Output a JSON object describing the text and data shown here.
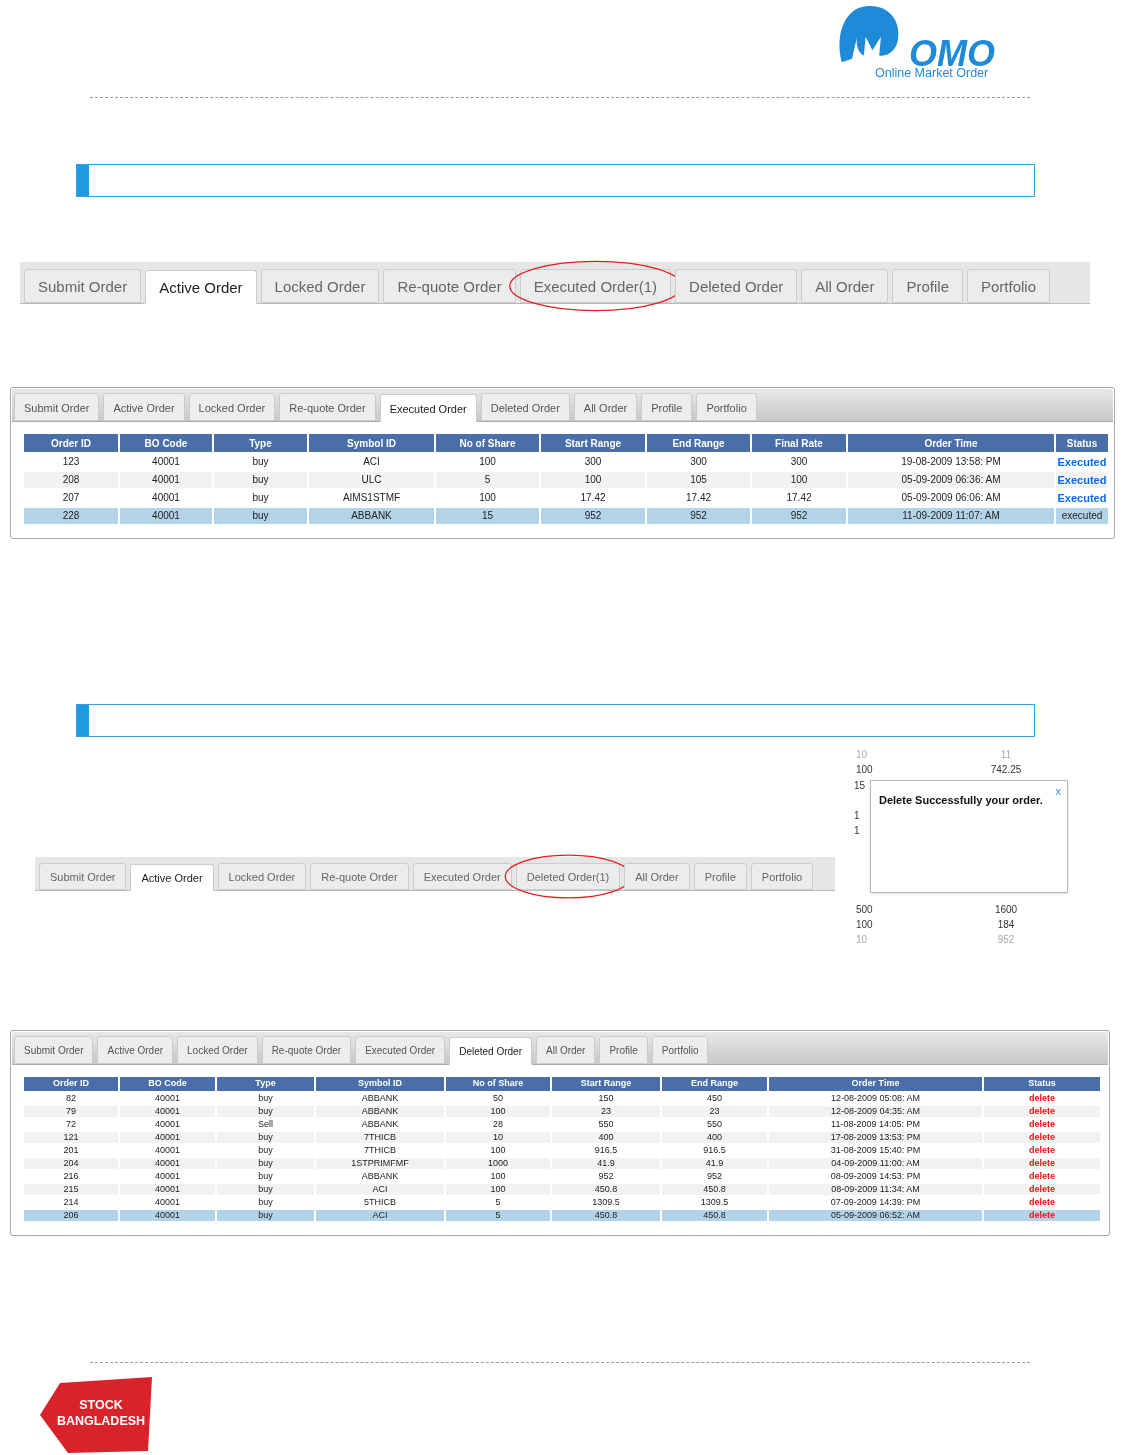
{
  "header_logo": {
    "wordmark": "OMO",
    "tagline": "Online Market Order"
  },
  "section_bars": [
    {
      "kind": "bar"
    },
    {
      "kind": "bar"
    }
  ],
  "main_tabs_1": [
    {
      "label": "Submit Order",
      "selected": false,
      "circled": false
    },
    {
      "label": "Active Order",
      "selected": true,
      "circled": false
    },
    {
      "label": "Locked Order",
      "selected": false,
      "circled": false
    },
    {
      "label": "Re-quote Order",
      "selected": false,
      "circled": false
    },
    {
      "label": "Executed Order(1)",
      "selected": false,
      "circled": true
    },
    {
      "label": "Deleted Order",
      "selected": false,
      "circled": false
    },
    {
      "label": "All Order",
      "selected": false,
      "circled": false
    },
    {
      "label": "Profile",
      "selected": false,
      "circled": false
    },
    {
      "label": "Portfolio",
      "selected": false,
      "circled": false
    }
  ],
  "executed_panel": {
    "kind": "executed",
    "tabs": [
      {
        "label": "Submit Order",
        "selected": false
      },
      {
        "label": "Active Order",
        "selected": false
      },
      {
        "label": "Locked Order",
        "selected": false
      },
      {
        "label": "Re-quote Order",
        "selected": false
      },
      {
        "label": "Executed Order",
        "selected": true
      },
      {
        "label": "Deleted Order",
        "selected": false
      },
      {
        "label": "All Order",
        "selected": false
      },
      {
        "label": "Profile",
        "selected": false
      },
      {
        "label": "Portfolio",
        "selected": false
      }
    ],
    "columns": [
      "Order ID",
      "BO Code",
      "Type",
      "Symbol ID",
      "No of Share",
      "Start Range",
      "End Range",
      "Final Rate",
      "Order Time",
      "Status"
    ],
    "rows": [
      {
        "cells": [
          "123",
          "40001",
          "buy",
          "ACI",
          "100",
          "300",
          "300",
          "300",
          "19-08-2009 13:58: PM",
          "Executed"
        ],
        "selected": false
      },
      {
        "cells": [
          "208",
          "40001",
          "buy",
          "ULC",
          "5",
          "100",
          "105",
          "100",
          "05-09-2009 06:36: AM",
          "Executed"
        ],
        "selected": false
      },
      {
        "cells": [
          "207",
          "40001",
          "buy",
          "AIMS1STMF",
          "100",
          "17.42",
          "17.42",
          "17.42",
          "05-09-2009 06:06: AM",
          "Executed"
        ],
        "selected": false
      },
      {
        "cells": [
          "228",
          "40001",
          "buy",
          "ABBANK",
          "15",
          "952",
          "952",
          "952",
          "11-09-2009 11:07: AM",
          "executed"
        ],
        "selected": true
      }
    ]
  },
  "main_tabs_2": [
    {
      "label": "Submit Order",
      "selected": false,
      "circled": false
    },
    {
      "label": "Active Order",
      "selected": true,
      "circled": false
    },
    {
      "label": "Locked Order",
      "selected": false,
      "circled": false
    },
    {
      "label": "Re-quote Order",
      "selected": false,
      "circled": false
    },
    {
      "label": "Executed Order",
      "selected": false,
      "circled": false
    },
    {
      "label": "Deleted Order(1)",
      "selected": false,
      "circled": true
    },
    {
      "label": "All Order",
      "selected": false,
      "circled": false
    },
    {
      "label": "Profile",
      "selected": false,
      "circled": false
    },
    {
      "label": "Portfolio",
      "selected": false,
      "circled": false
    }
  ],
  "popup_fragment": {
    "rows_above": [
      [
        "10",
        "11"
      ],
      [
        "100",
        "742.25"
      ]
    ],
    "peeks": [
      "15",
      "1",
      "1"
    ],
    "rows_below": [
      [
        "500",
        "1600"
      ],
      [
        "100",
        "184"
      ],
      [
        "10",
        "952"
      ]
    ],
    "message": "Delete Successfully your order.",
    "close": "x"
  },
  "deleted_panel": {
    "kind": "deleted",
    "tabs": [
      {
        "label": "Submit Order",
        "selected": false
      },
      {
        "label": "Active Order",
        "selected": false
      },
      {
        "label": "Locked Order",
        "selected": false
      },
      {
        "label": "Re-quote Order",
        "selected": false
      },
      {
        "label": "Executed Order",
        "selected": false
      },
      {
        "label": "Deleted Order",
        "selected": true
      },
      {
        "label": "All Order",
        "selected": false
      },
      {
        "label": "Profile",
        "selected": false
      },
      {
        "label": "Portfolio",
        "selected": false
      }
    ],
    "columns": [
      "Order ID",
      "BO Code",
      "Type",
      "Symbol ID",
      "No of Share",
      "Start Range",
      "End Range",
      "Order Time",
      "Status"
    ],
    "rows": [
      {
        "cells": [
          "82",
          "40001",
          "buy",
          "ABBANK",
          "50",
          "150",
          "450",
          "12-08-2009 05:08: AM",
          "delete"
        ],
        "selected": false
      },
      {
        "cells": [
          "79",
          "40001",
          "buy",
          "ABBANK",
          "100",
          "23",
          "23",
          "12-08-2009 04:35: AM",
          "delete"
        ],
        "selected": false
      },
      {
        "cells": [
          "72",
          "40001",
          "Sell",
          "ABBANK",
          "28",
          "550",
          "550",
          "11-08-2009 14:05: PM",
          "delete"
        ],
        "selected": false
      },
      {
        "cells": [
          "121",
          "40001",
          "buy",
          "7THICB",
          "10",
          "400",
          "400",
          "17-08-2009 13:53: PM",
          "delete"
        ],
        "selected": false
      },
      {
        "cells": [
          "201",
          "40001",
          "buy",
          "7THICB",
          "100",
          "916.5",
          "916.5",
          "31-08-2009 15:40: PM",
          "delete"
        ],
        "selected": false
      },
      {
        "cells": [
          "204",
          "40001",
          "buy",
          "1STPRIMFMF",
          "1000",
          "41.9",
          "41.9",
          "04-09-2009 11:00: AM",
          "delete"
        ],
        "selected": false
      },
      {
        "cells": [
          "216",
          "40001",
          "buy",
          "ABBANK",
          "100",
          "952",
          "952",
          "08-09-2009 14:53: PM",
          "delete"
        ],
        "selected": false
      },
      {
        "cells": [
          "215",
          "40001",
          "buy",
          "ACI",
          "100",
          "450.8",
          "450.8",
          "08-09-2009 11:34: AM",
          "delete"
        ],
        "selected": false
      },
      {
        "cells": [
          "214",
          "40001",
          "buy",
          "5THICB",
          "5",
          "1309.5",
          "1309.5",
          "07-09-2009 14:39: PM",
          "delete"
        ],
        "selected": false
      },
      {
        "cells": [
          "206",
          "40001",
          "buy",
          "ACI",
          "5",
          "450.8",
          "450.8",
          "05-09-2009 06:52: AM",
          "delete"
        ],
        "selected": true
      }
    ]
  },
  "footer_logo": {
    "text": "STOCK BANGLADESH"
  }
}
